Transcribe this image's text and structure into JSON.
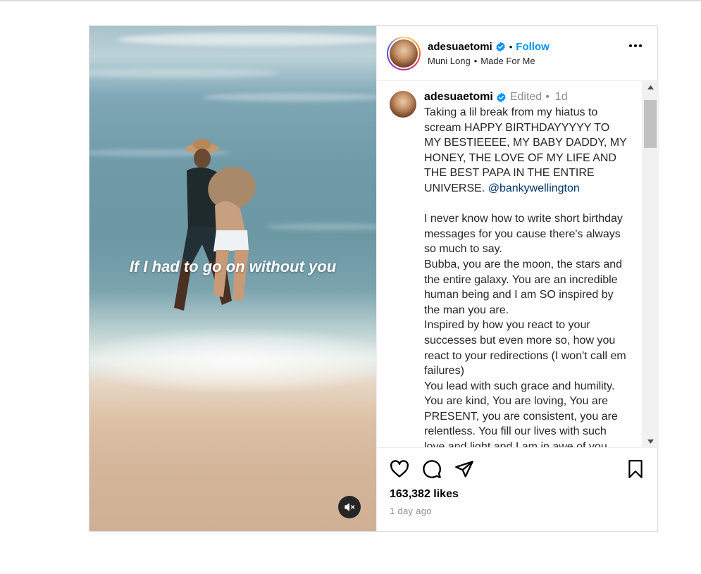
{
  "video": {
    "overlay_text": "If I had to go on without you",
    "mute_icon": "speaker-muted-icon"
  },
  "header": {
    "username": "adesuaetomi",
    "verified_icon": "verified-badge-icon",
    "dot": "•",
    "follow_label": "Follow",
    "audio_artist": "Muni Long",
    "audio_sep": "•",
    "audio_song": "Made For Me",
    "more_icon": "more-options-icon"
  },
  "caption": {
    "username": "adesuaetomi",
    "edited": "Edited",
    "dot": "•",
    "age": "1d",
    "para1": "Taking a lil break from my hiatus to scream HAPPY BIRTHDAYYYYY TO MY BESTIEEEE, MY BABY DADDY, MY HONEY, THE LOVE OF MY LIFE AND THE BEST PAPA IN THE ENTIRE UNIVERSE.",
    "mention": "@bankywellington",
    "para2": "I never know how to write short birthday messages for you cause there's always so much to say.",
    "para3": "Bubba, you are the moon, the stars and the entire galaxy. You are an incredible human being and I am SO inspired by the man you are.",
    "para4": "Inspired by how you react to your successes but even more so, how you react to your redirections (I won't call em failures)",
    "para5": "You lead with such grace and humility. You are kind, You are loving, You are PRESENT, you are consistent, you are relentless. You fill our lives with such love and light and I am in awe of you."
  },
  "actions": {
    "like_icon": "heart-icon",
    "comment_icon": "comment-icon",
    "share_icon": "share-icon",
    "save_icon": "bookmark-icon",
    "likes": "163,382 likes",
    "time": "1 day ago"
  },
  "colors": {
    "follow": "#0095f6",
    "mention": "#00376b",
    "verified": "#0095f6",
    "muted_text": "#8e8e8e"
  }
}
